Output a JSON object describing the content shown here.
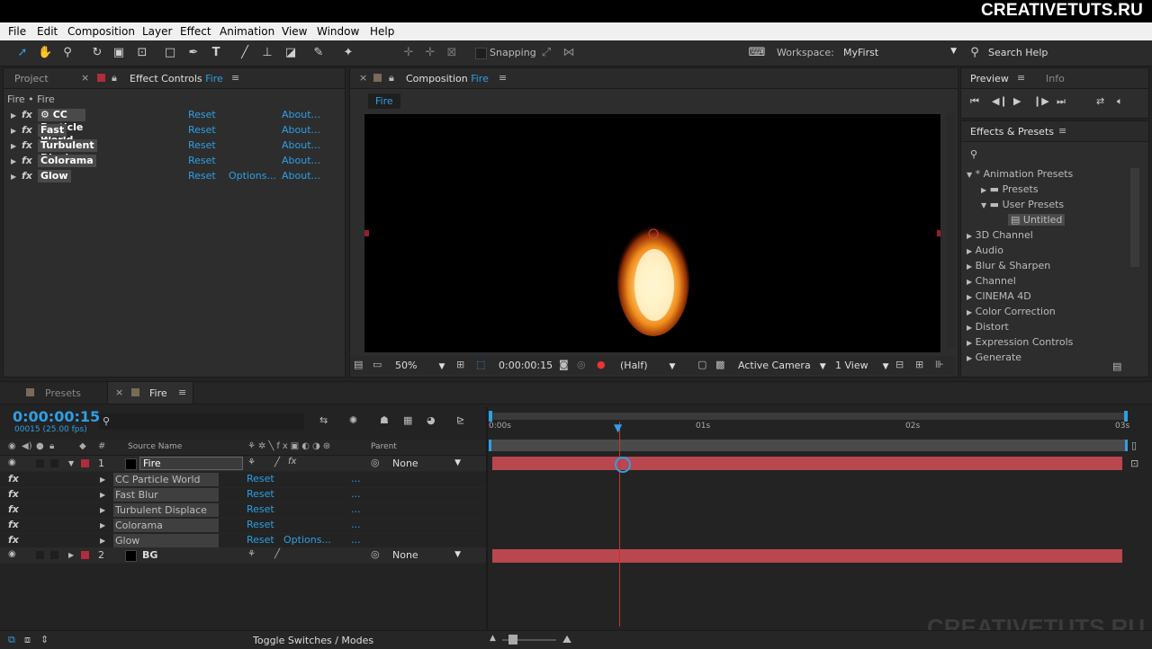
{
  "brand": "CREATIVETUTS.RU",
  "watermark": "CREATIVETUTS.RU",
  "menu": [
    "File",
    "Edit",
    "Composition",
    "Layer",
    "Effect",
    "Animation",
    "View",
    "Window",
    "Help"
  ],
  "toolbar": {
    "snapping": "Snapping",
    "workspace_label": "Workspace:",
    "workspace_value": "MyFirst",
    "search_help": "Search Help"
  },
  "left_panel": {
    "tab_project": "Project",
    "tab_effect_controls": "Effect Controls",
    "tab_effect_target": "Fire",
    "breadcrumb": "Fire • Fire",
    "effects": [
      {
        "name": "CC Particle World",
        "reset": "Reset",
        "options": "",
        "about": "About..."
      },
      {
        "name": "Fast Blur",
        "reset": "Reset",
        "options": "",
        "about": "About..."
      },
      {
        "name": "Turbulent Displace",
        "reset": "Reset",
        "options": "",
        "about": "About..."
      },
      {
        "name": "Colorama",
        "reset": "Reset",
        "options": "",
        "about": "About..."
      },
      {
        "name": "Glow",
        "reset": "Reset",
        "options": "Options...",
        "about": "About..."
      }
    ]
  },
  "composition": {
    "tab_label": "Composition",
    "tab_target": "Fire",
    "subtab": "Fire",
    "zoom": "50%",
    "timecode": "0:00:00:15",
    "resolution": "(Half)",
    "camera": "Active Camera",
    "views": "1 View"
  },
  "right_panel": {
    "tab_preview": "Preview",
    "tab_info": "Info",
    "effects_presets_title": "Effects & Presets",
    "tree": [
      {
        "label": "* Animation Presets",
        "level": 0,
        "open": true,
        "folder": false
      },
      {
        "label": "Presets",
        "level": 1,
        "open": false,
        "folder": true
      },
      {
        "label": "User Presets",
        "level": 1,
        "open": true,
        "folder": true
      },
      {
        "label": "Untitled",
        "level": 2,
        "open": false,
        "folder": false,
        "selected": true
      },
      {
        "label": "3D Channel",
        "level": 0,
        "open": false,
        "folder": false
      },
      {
        "label": "Audio",
        "level": 0,
        "open": false,
        "folder": false
      },
      {
        "label": "Blur & Sharpen",
        "level": 0,
        "open": false,
        "folder": false
      },
      {
        "label": "Channel",
        "level": 0,
        "open": false,
        "folder": false
      },
      {
        "label": "CINEMA 4D",
        "level": 0,
        "open": false,
        "folder": false
      },
      {
        "label": "Color Correction",
        "level": 0,
        "open": false,
        "folder": false
      },
      {
        "label": "Distort",
        "level": 0,
        "open": false,
        "folder": false
      },
      {
        "label": "Expression Controls",
        "level": 0,
        "open": false,
        "folder": false
      },
      {
        "label": "Generate",
        "level": 0,
        "open": false,
        "folder": false
      }
    ]
  },
  "timeline": {
    "tab_presets": "Presets",
    "tab_fire": "Fire",
    "timecode": "0:00:00:15",
    "frame_info": "00015 (25.00 fps)",
    "col_source": "Source Name",
    "col_parent": "Parent",
    "ruler": [
      "0:00s",
      "01s",
      "02s",
      "03s"
    ],
    "layers": [
      {
        "num": "1",
        "name": "Fire",
        "parent": "None"
      },
      {
        "num": "2",
        "name": "BG",
        "parent": "None"
      }
    ],
    "effects": [
      {
        "name": "CC Particle World",
        "reset": "Reset",
        "options": "",
        "dots": "..."
      },
      {
        "name": "Fast Blur",
        "reset": "Reset",
        "options": "",
        "dots": "..."
      },
      {
        "name": "Turbulent Displace",
        "reset": "Reset",
        "options": "",
        "dots": "..."
      },
      {
        "name": "Colorama",
        "reset": "Reset",
        "options": "",
        "dots": "..."
      },
      {
        "name": "Glow",
        "reset": "Reset",
        "options": "Options...",
        "dots": "..."
      }
    ],
    "toggle_label": "Toggle Switches / Modes",
    "playhead_fraction": 0.206
  },
  "colors": {
    "accent": "#2e9fe5",
    "layer_bar": "#b8474f",
    "label_red": "#b12c3c"
  }
}
